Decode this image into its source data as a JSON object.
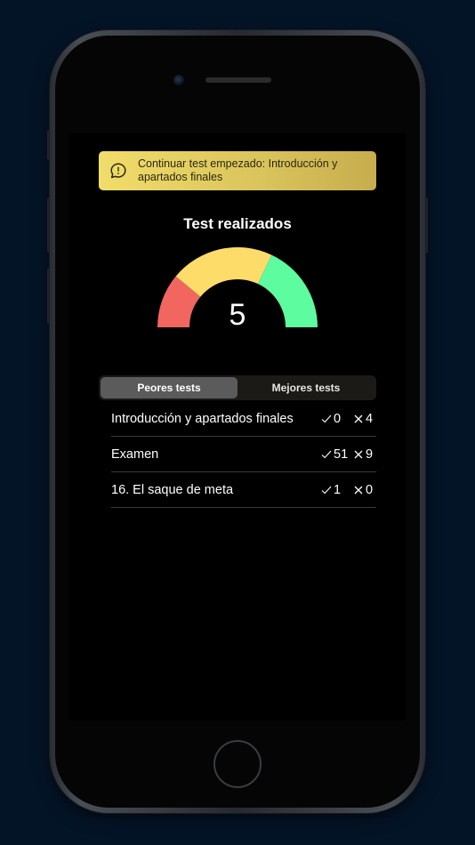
{
  "banner": {
    "text": "Continuar test empezado: Introducción y apartados finales",
    "icon": "chat-info-icon"
  },
  "title": "Test realizados",
  "gauge": {
    "value": "5",
    "segments": [
      {
        "color": "#f26660",
        "from": 0.0,
        "to": 0.22
      },
      {
        "color": "#fedc6a",
        "from": 0.22,
        "to": 0.64
      },
      {
        "color": "#5dfc9f",
        "from": 0.64,
        "to": 1.0
      }
    ]
  },
  "tabs": [
    {
      "label": "Peores tests",
      "active": true
    },
    {
      "label": "Mejores tests",
      "active": false
    }
  ],
  "tests": [
    {
      "name": "Introducción y apartados finales",
      "correct": "0",
      "wrong": "4"
    },
    {
      "name": "Examen",
      "correct": "51",
      "wrong": "9"
    },
    {
      "name": "16. El saque de meta",
      "correct": "1",
      "wrong": "0"
    }
  ],
  "colors": {
    "background": "#041427",
    "banner": "#e8d462",
    "active_tab": "#5b5b5b"
  }
}
